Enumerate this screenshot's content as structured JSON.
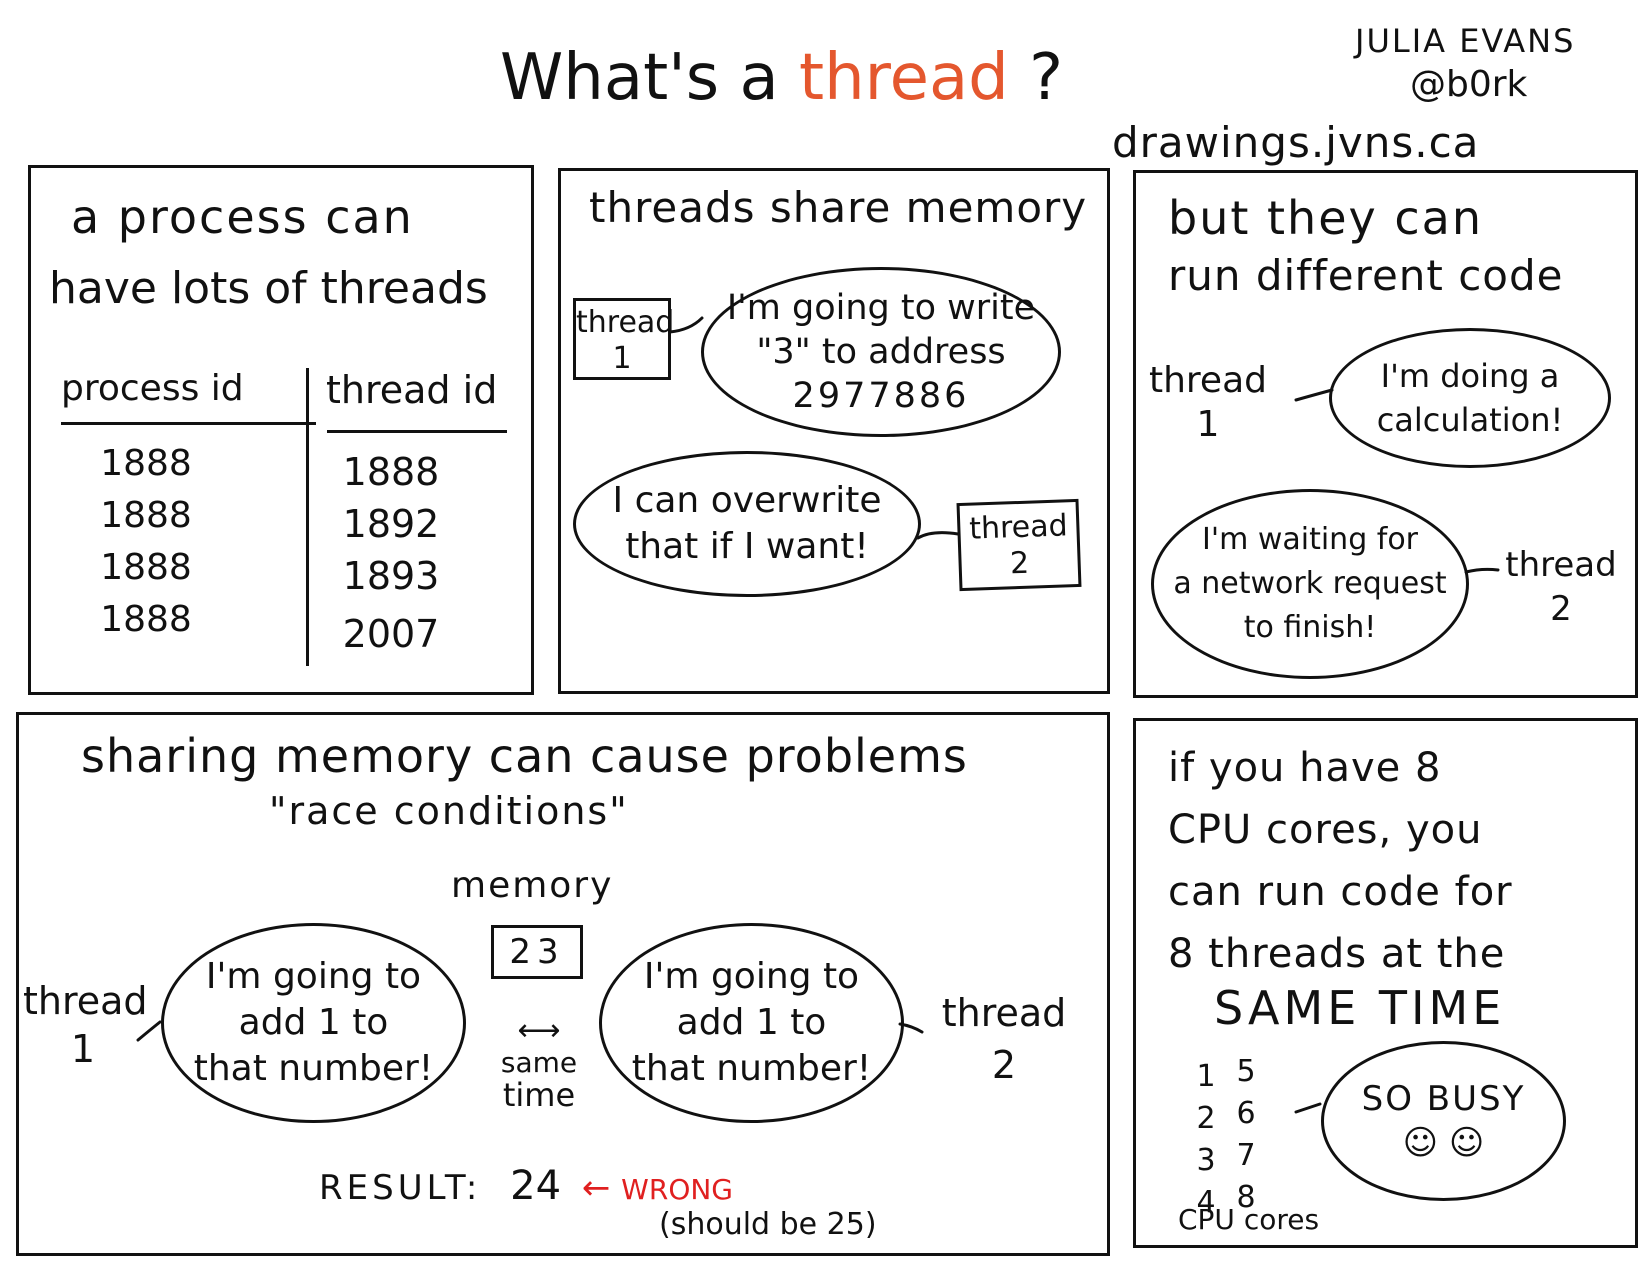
{
  "title": {
    "prefix": "What's a",
    "highlight": "thread",
    "suffix": "?"
  },
  "author": {
    "name": "JULIA EVANS",
    "handle": "@b0rk",
    "site": "drawings.jvns.ca"
  },
  "colors": {
    "highlight": "#e4572e",
    "wrong": "#e02020",
    "ink": "#111111"
  },
  "panel1": {
    "heading_line1": "a process can",
    "heading_line2": "have lots of threads",
    "table": {
      "headers": [
        "process id",
        "thread id"
      ],
      "rows": [
        [
          "1888",
          "1888"
        ],
        [
          "1888",
          "1892"
        ],
        [
          "1888",
          "1893"
        ],
        [
          "1888",
          "2007"
        ]
      ]
    }
  },
  "panel2": {
    "heading": "threads share memory",
    "thread1_label": [
      "thread",
      "1"
    ],
    "thread1_says": [
      "I'm going to write",
      "\"3\" to address",
      "2977886"
    ],
    "thread2_label": [
      "thread",
      "2"
    ],
    "thread2_says": [
      "I can overwrite",
      "that if I want!"
    ]
  },
  "panel3": {
    "heading_line1": "but they can",
    "heading_line2": "run different code",
    "thread1_label": [
      "thread",
      "1"
    ],
    "thread1_says": [
      "I'm doing a",
      "calculation!"
    ],
    "thread2_label": [
      "thread",
      "2"
    ],
    "thread2_says": [
      "I'm waiting for",
      "a network request",
      "to finish!"
    ]
  },
  "panel4": {
    "heading": "sharing memory can cause problems",
    "subheading": "\"race conditions\"",
    "memory_label": "memory",
    "memory_value": "23",
    "thread1_label": [
      "thread",
      "1"
    ],
    "thread2_label": [
      "thread",
      "2"
    ],
    "bubble_text": [
      "I'm going to",
      "add 1 to",
      "that number!"
    ],
    "same_time": [
      "same",
      "time"
    ],
    "result_label": "RESULT:",
    "result_value": "24",
    "wrong_label": "WRONG",
    "correction": "(should be 25)"
  },
  "panel5": {
    "lines": [
      "if you have 8",
      "CPU cores, you",
      "can run code for",
      "8 threads at the"
    ],
    "emphasis": "SAME TIME",
    "cores_col1": [
      "1",
      "2",
      "3",
      "4"
    ],
    "cores_col2": [
      "5",
      "6",
      "7",
      "8"
    ],
    "cores_label": "CPU cores",
    "busy_text": "SO BUSY",
    "faces": "☺ ☺"
  }
}
